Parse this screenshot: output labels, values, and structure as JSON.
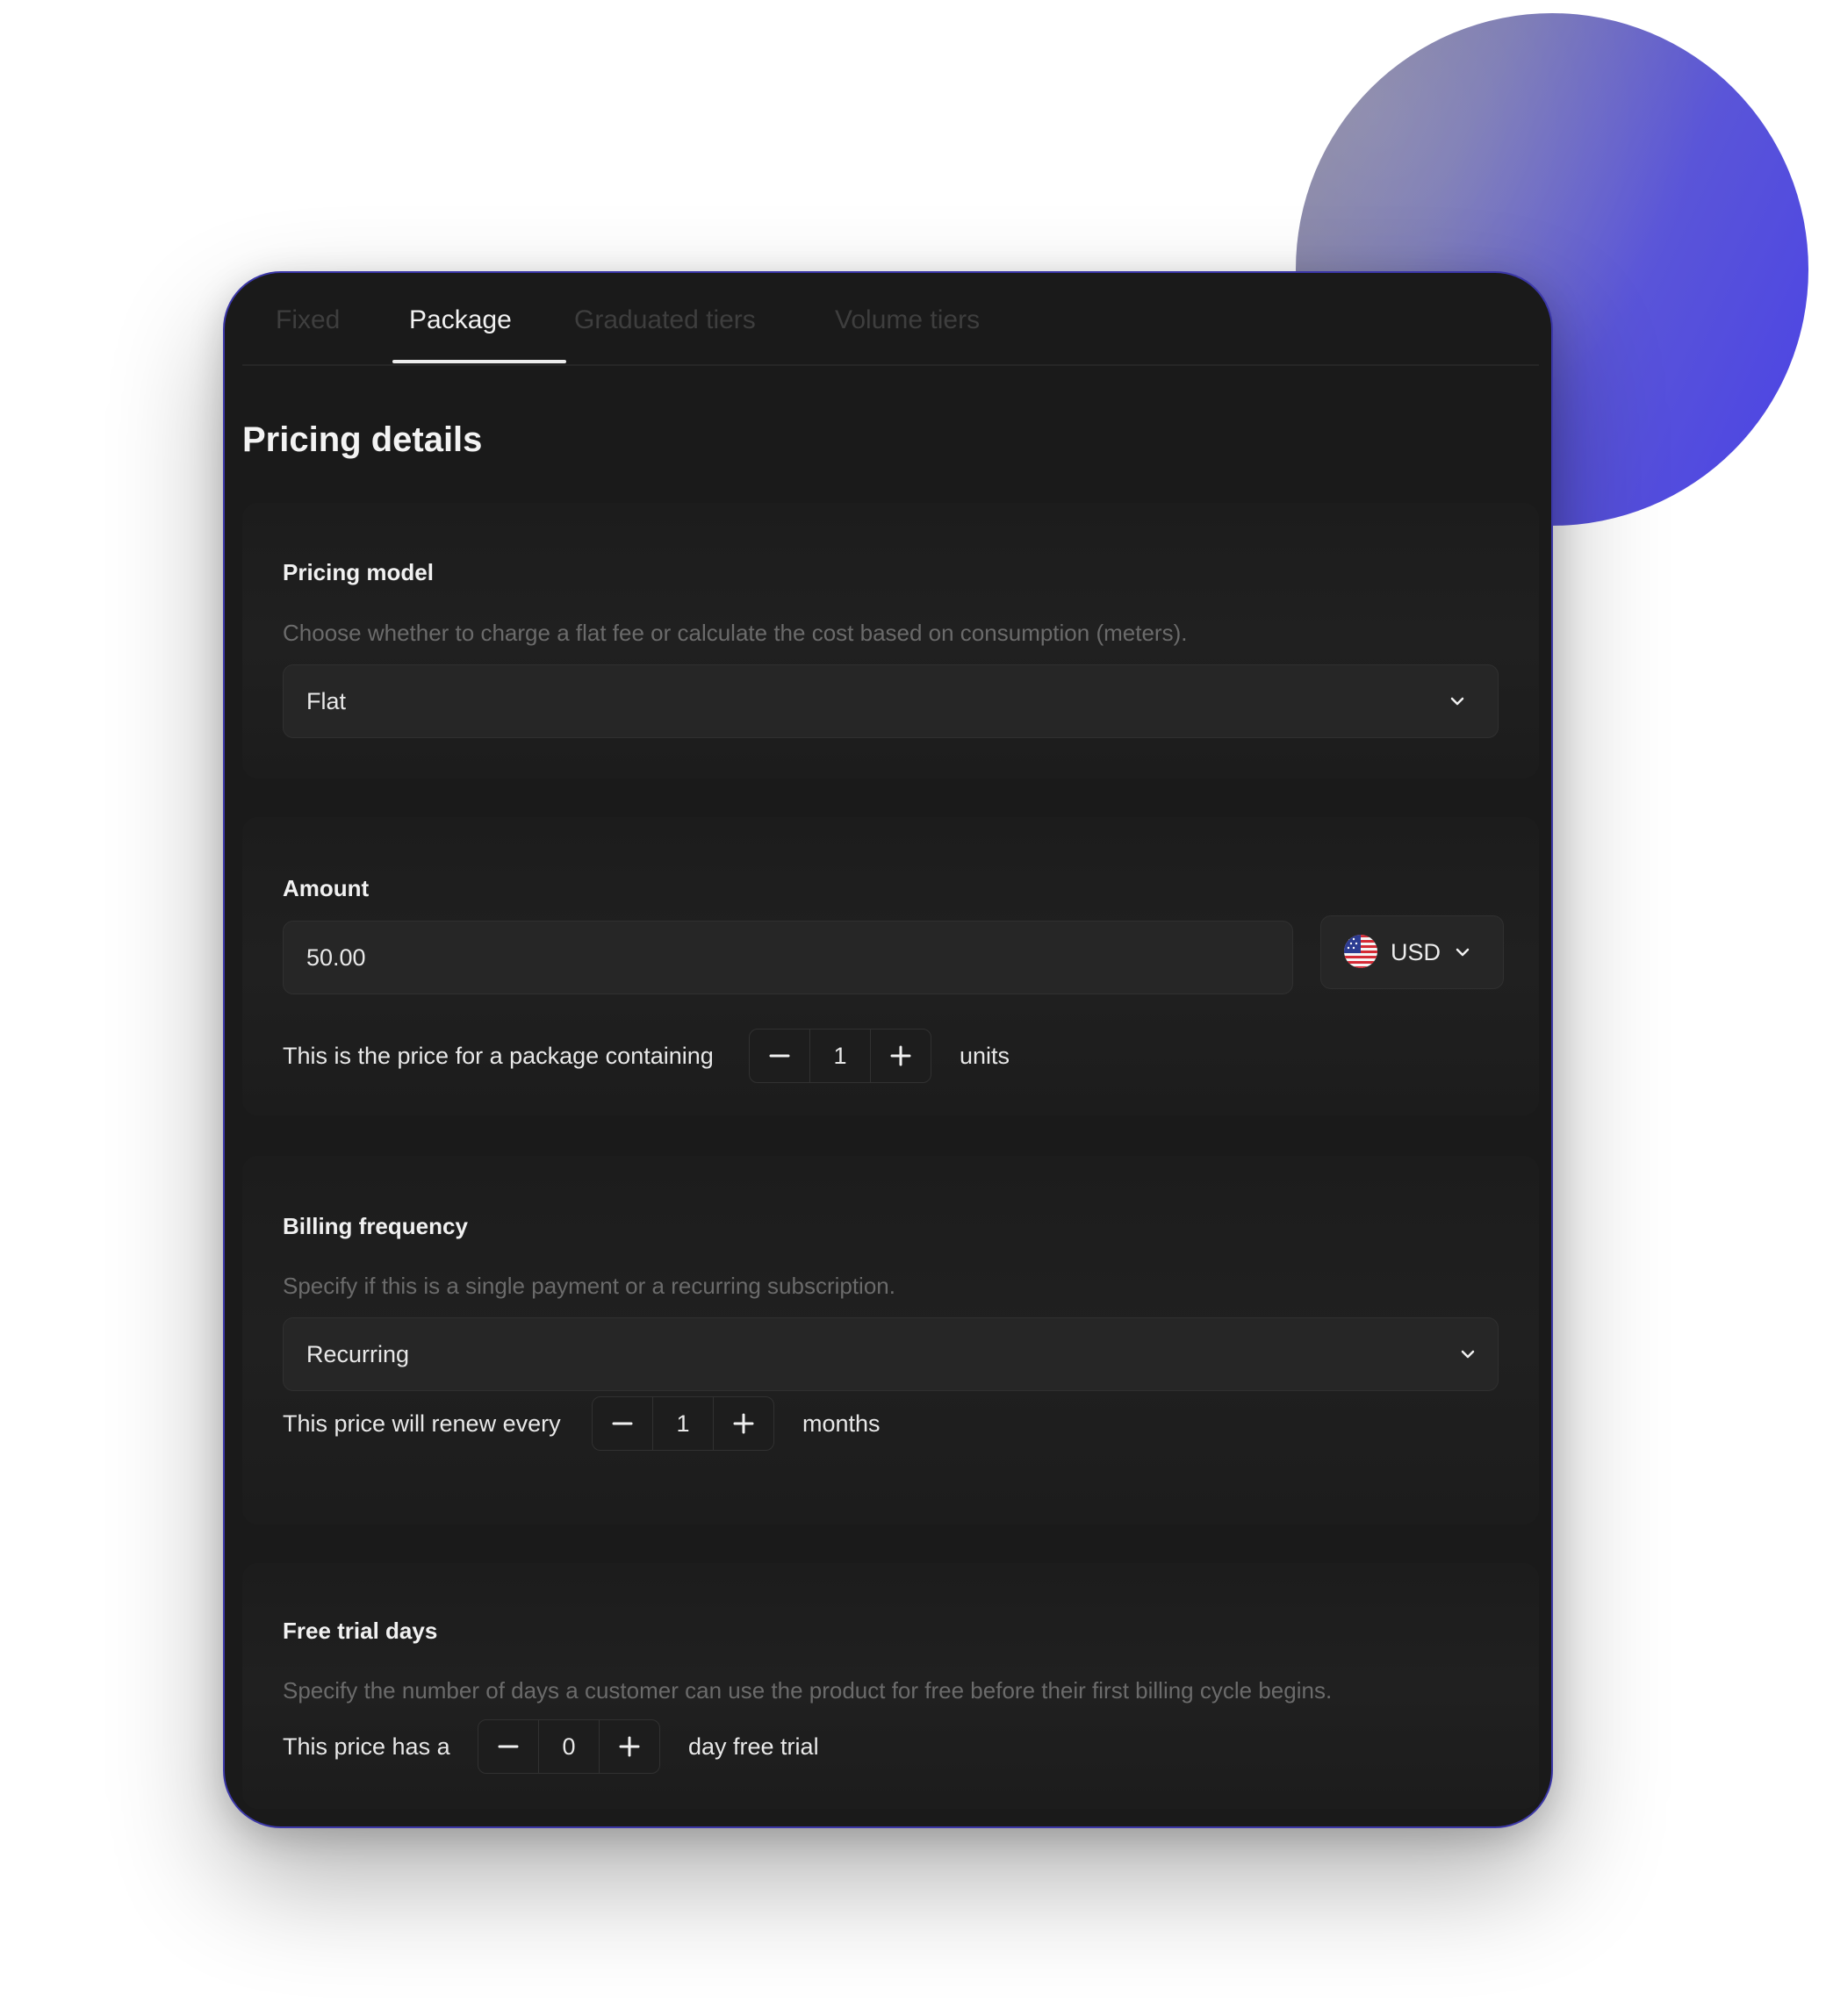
{
  "tabs": [
    {
      "label": "Fixed",
      "active": false
    },
    {
      "label": "Package",
      "active": true
    },
    {
      "label": "Graduated tiers",
      "active": false
    },
    {
      "label": "Volume tiers",
      "active": false
    }
  ],
  "page_title": "Pricing details",
  "pricing_model": {
    "label": "Pricing model",
    "description": "Choose whether to charge a flat fee or calculate the cost based on consumption (meters).",
    "selected": "Flat"
  },
  "amount": {
    "label": "Amount",
    "value": "50.00",
    "currency": "USD",
    "package_prefix": "This is the price for a package containing",
    "package_units": "1",
    "package_suffix": "units"
  },
  "billing_frequency": {
    "label": "Billing frequency",
    "description": "Specify if this is a single payment or a recurring subscription.",
    "selected": "Recurring",
    "renew_prefix": "This price will renew every",
    "renew_value": "1",
    "renew_suffix": "months"
  },
  "free_trial": {
    "label": "Free trial days",
    "description": "Specify the number of days a customer can use the product for free before their first billing cycle begins.",
    "trial_prefix": "This price has a",
    "trial_value": "0",
    "trial_suffix": "day free trial"
  },
  "icons": {
    "chevron": "chevron-down-icon",
    "minus": "minus-icon",
    "plus": "plus-icon",
    "flag": "us-flag-icon"
  },
  "colors": {
    "card_background": "#1a1a1a",
    "card_border": "#3b37a8",
    "accent_blob": "#4a42e6"
  }
}
